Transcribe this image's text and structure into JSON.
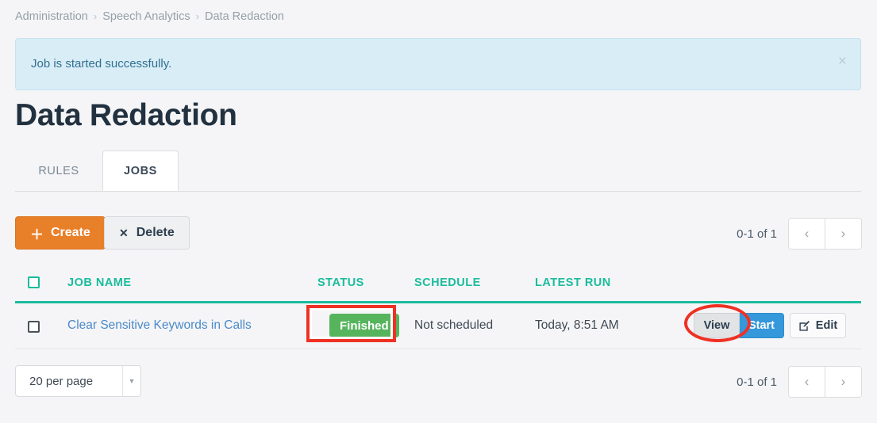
{
  "breadcrumb": {
    "items": [
      "Administration",
      "Speech Analytics",
      "Data Redaction"
    ],
    "separator": "›"
  },
  "alert": {
    "message": "Job is started successfully.",
    "close_icon": "×",
    "background": "#d9edf7",
    "text_color": "#31708f"
  },
  "page_title": "Data Redaction",
  "tabs": [
    {
      "label": "RULES",
      "active": false
    },
    {
      "label": "JOBS",
      "active": true
    }
  ],
  "toolbar": {
    "create_label": "Create",
    "create_icon": "＋",
    "create_color": "#e8802a",
    "delete_label": "Delete",
    "delete_icon": "✕"
  },
  "pagination": {
    "range_label": "0-1 of 1",
    "prev_icon": "‹",
    "next_icon": "›"
  },
  "per_page": {
    "selected": "20 per page",
    "arrow_icon": "▼",
    "options": [
      "20 per page"
    ]
  },
  "table": {
    "header_color": "#1abc9c",
    "columns": [
      "JOB NAME",
      "STATUS",
      "SCHEDULE",
      "LATEST RUN"
    ],
    "rows": [
      {
        "job_name": "Clear Sensitive Keywords in Calls",
        "status": "Finished",
        "status_color": "#56b45d",
        "schedule": "Not scheduled",
        "latest_run": "Today, 8:51 AM",
        "actions": {
          "view_label": "View",
          "start_label": "Start",
          "start_color": "#3498db",
          "edit_label": "Edit",
          "edit_icon": "pencil-square-icon"
        }
      }
    ]
  },
  "annotations": {
    "color": "#ee3124",
    "rect_target": "status-badge",
    "ellipse_target": "view-button"
  }
}
